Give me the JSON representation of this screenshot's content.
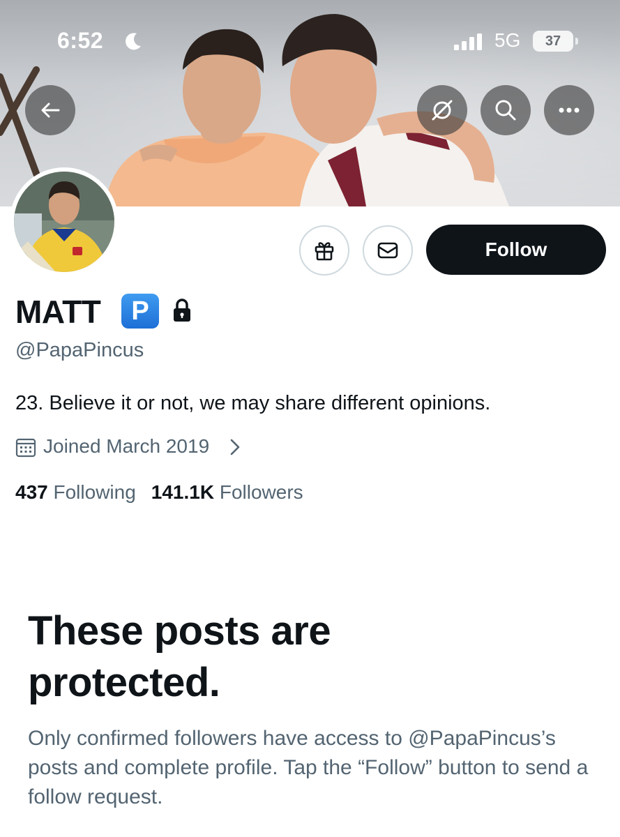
{
  "status_bar": {
    "time": "6:52",
    "network": "5G",
    "battery": "37"
  },
  "profile": {
    "display_name": "MATT",
    "badge_letter": "P",
    "handle": "@PapaPincus",
    "bio": "23. Believe it or not, we may share different opinions.",
    "joined": "Joined March 2019",
    "following_count": "437",
    "following_label": "Following",
    "followers_count": "141.1K",
    "followers_label": "Followers"
  },
  "actions": {
    "follow_label": "Follow"
  },
  "protected": {
    "title": "These posts are protected.",
    "description": "Only confirmed followers have access to @PapaPincus’s posts and complete profile. Tap the “Follow” button to send a follow request."
  },
  "icons": [
    "moon-icon",
    "signal-icon",
    "back-arrow-icon",
    "grok-icon",
    "search-icon",
    "more-icon",
    "gift-icon",
    "message-icon",
    "lock-icon",
    "calendar-icon",
    "chevron-right-icon"
  ],
  "colors": {
    "primary_text": "#0f1419",
    "secondary_text": "#536471",
    "follow_button": "#0f1419",
    "badge": "#1d9bf0",
    "border": "#cfd9de"
  }
}
